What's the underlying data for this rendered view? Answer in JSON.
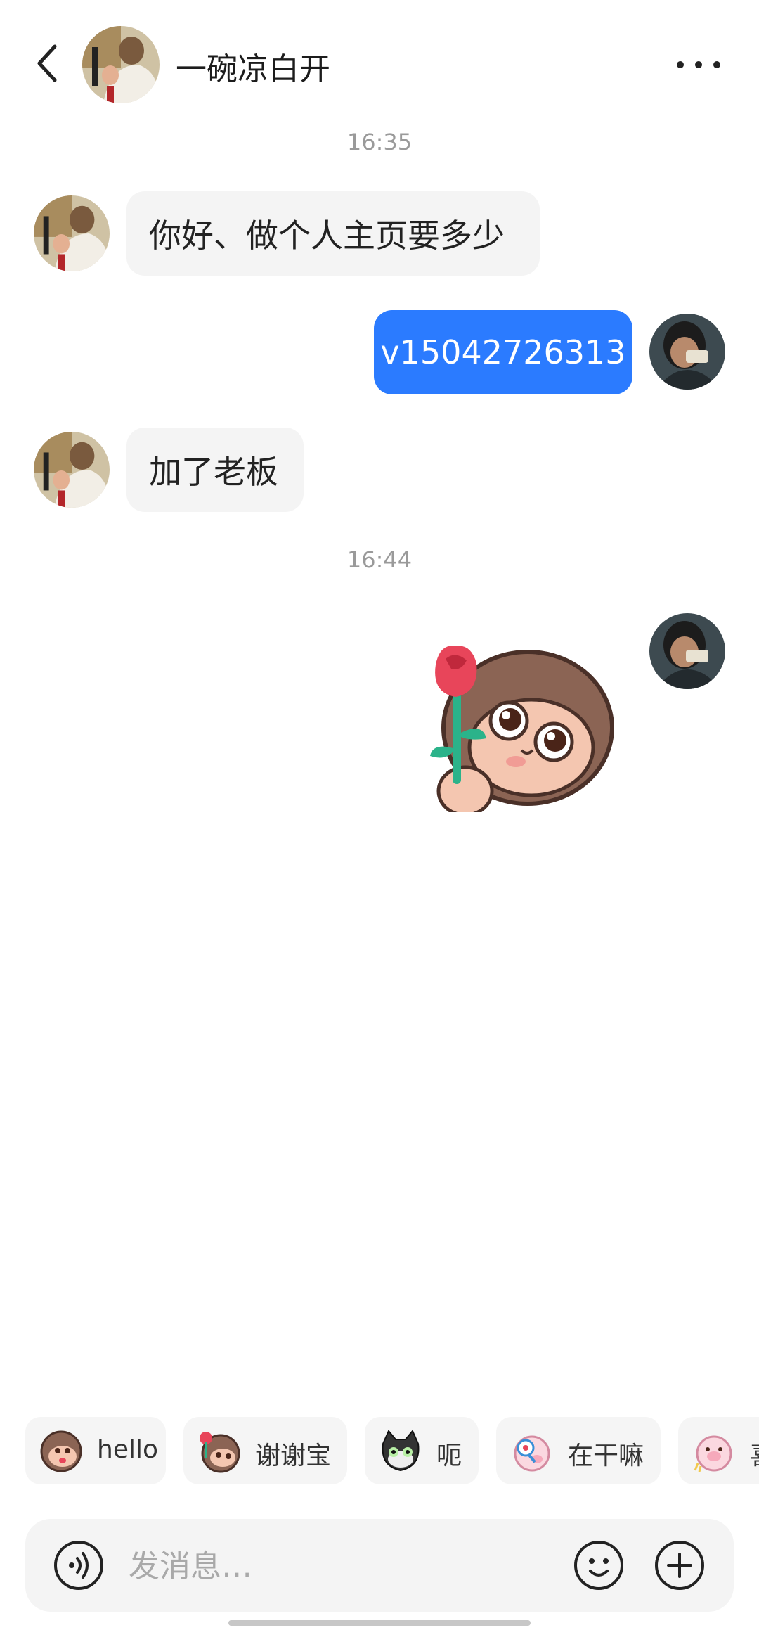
{
  "header": {
    "contact_name": "一碗凉白开",
    "back_icon": "chevron-left-icon",
    "more_icon": "more-horizontal-icon"
  },
  "messages": [
    {
      "type": "time",
      "text": "16:35"
    },
    {
      "type": "text",
      "direction": "incoming",
      "text": "你好、做个人主页要多少"
    },
    {
      "type": "text",
      "direction": "outgoing",
      "text": "v15042726313"
    },
    {
      "type": "text",
      "direction": "incoming",
      "text": "加了老板"
    },
    {
      "type": "time",
      "text": "16:44"
    },
    {
      "type": "sticker",
      "direction": "outgoing",
      "sticker": "monkey-with-rose-sticker"
    }
  ],
  "quick_replies": [
    {
      "label": "hello",
      "icon": "monkey-icon"
    },
    {
      "label": "谢谢宝",
      "icon": "monkey-rose-icon"
    },
    {
      "label": "呃",
      "icon": "cat-icon"
    },
    {
      "label": "在干嘛",
      "icon": "pig-magnifier-icon"
    },
    {
      "label": "喜",
      "icon": "pig-icon"
    }
  ],
  "input": {
    "placeholder": "发消息…"
  },
  "colors": {
    "outgoing_bubble": "#2b7bff",
    "incoming_bubble": "#f4f4f4",
    "timestamp": "#9a9a9a"
  }
}
